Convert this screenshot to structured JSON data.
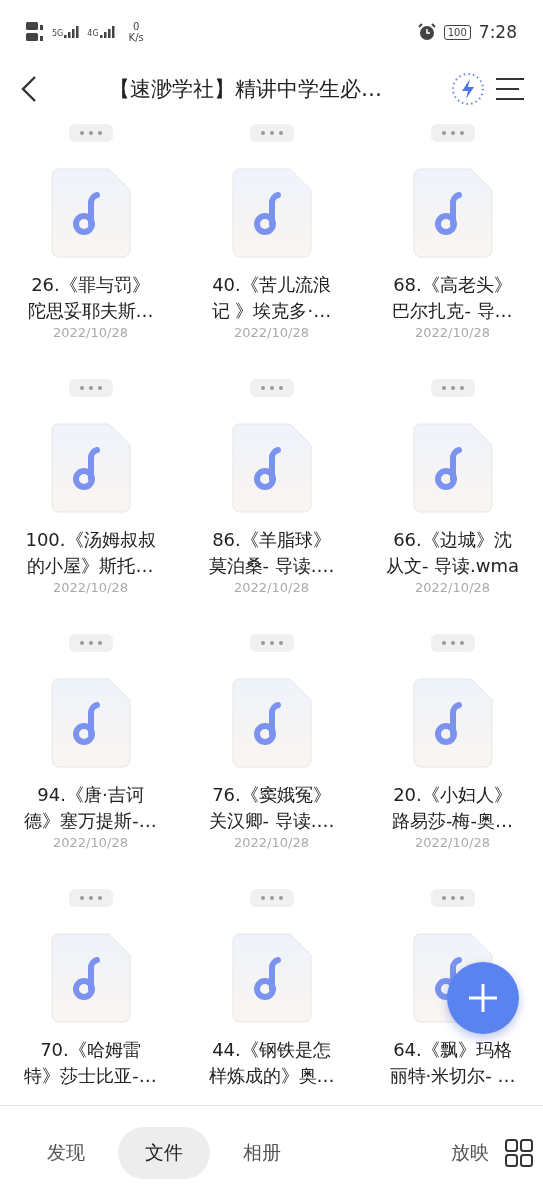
{
  "status_bar": {
    "network_labels": [
      "5G",
      "4G"
    ],
    "speed_value": "0",
    "speed_unit": "K/s",
    "battery": "100",
    "time": "7:28"
  },
  "header": {
    "title": "【速渺学社】精讲中学生必…"
  },
  "files": [
    {
      "lines": [
        "26.《罪与罚》",
        "陀思妥耶夫斯…"
      ],
      "date": "2022/10/28"
    },
    {
      "lines": [
        "40.《苦儿流浪",
        "记 》埃克多·…"
      ],
      "date": "2022/10/28"
    },
    {
      "lines": [
        "68.《高老头》",
        "巴尔扎克- 导…"
      ],
      "date": "2022/10/28"
    },
    {
      "lines": [
        "100.《汤姆叔叔",
        "的小屋》斯托…"
      ],
      "date": "2022/10/28"
    },
    {
      "lines": [
        "86.《羊脂球》",
        "莫泊桑- 导读.…"
      ],
      "date": "2022/10/28"
    },
    {
      "lines": [
        "66.《边城》沈",
        "从文- 导读.wma"
      ],
      "date": "2022/10/28"
    },
    {
      "lines": [
        "94.《唐·吉诃",
        "德》塞万提斯-…"
      ],
      "date": "2022/10/28"
    },
    {
      "lines": [
        "76.《窦娥冤》",
        "关汉卿- 导读.…"
      ],
      "date": "2022/10/28"
    },
    {
      "lines": [
        "20.《小妇人》",
        "路易莎-梅-奥…"
      ],
      "date": "2022/10/28"
    },
    {
      "lines": [
        "70.《哈姆雷",
        "特》莎士比亚-…"
      ]
    },
    {
      "lines": [
        "44.《钢铁是怎",
        "样炼成的》奥…"
      ]
    },
    {
      "lines": [
        "64.《飘》玛格",
        "丽特·米切尔- …"
      ]
    }
  ],
  "tabs": [
    {
      "label": "发现",
      "selected": false
    },
    {
      "label": "文件",
      "selected": true
    },
    {
      "label": "相册",
      "selected": false
    },
    {
      "label": "放映",
      "selected": false
    }
  ]
}
